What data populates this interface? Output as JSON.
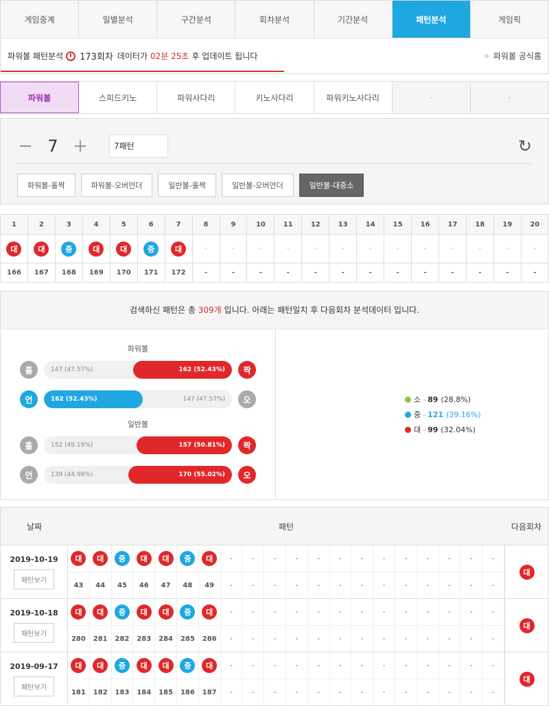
{
  "tabs": [
    "게임중계",
    "일별분석",
    "구간분석",
    "회차분석",
    "기간분석",
    "패턴분석",
    "게임픽"
  ],
  "active_tab": 5,
  "notice": {
    "prefix": "파워볼 패턴분석",
    "round": "173회차",
    "mid": "데이터가",
    "time": "02분 25초",
    "suffix": "후 업데이트 됩니다",
    "link": "파워볼 공식홈"
  },
  "subtabs": [
    "파워볼",
    "스피드키노",
    "파워사다리",
    "키노사다리",
    "파워키노사다리",
    "-",
    "-"
  ],
  "control": {
    "minus": "−",
    "value": "7",
    "plus": "+",
    "pattern_input": "7패턴",
    "buttons": [
      "파워볼-홀짝",
      "파워볼-오버언더",
      "일반볼-홀짝",
      "일반볼-오버언더",
      "일반볼-대중소"
    ]
  },
  "pattern": {
    "headers": [
      "1",
      "2",
      "3",
      "4",
      "5",
      "6",
      "7",
      "8",
      "9",
      "10",
      "11",
      "12",
      "13",
      "14",
      "15",
      "16",
      "17",
      "18",
      "19",
      "20"
    ],
    "balls": [
      "대",
      "대",
      "중",
      "대",
      "대",
      "중",
      "대",
      "-",
      "-",
      "-",
      "-",
      "-",
      "-",
      "-",
      "-",
      "-",
      "-",
      "-",
      "-",
      "-"
    ],
    "rounds": [
      "166",
      "167",
      "168",
      "169",
      "170",
      "171",
      "172",
      "-",
      "-",
      "-",
      "-",
      "-",
      "-",
      "-",
      "-",
      "-",
      "-",
      "-",
      "-",
      "-"
    ]
  },
  "result": {
    "pre": "검색하신 패턴은 총",
    "count": "309개",
    "post": "입니다. 아래는 패턴일치 후 다음회차 분석데이터 입니다."
  },
  "stats": {
    "power_title": "파워볼",
    "normal_title": "일반볼",
    "bars": [
      {
        "left": "홀",
        "right": "짝",
        "left_text": "147 (47.57%)",
        "right_text": "162 (52.43%)",
        "fill_side": "right",
        "pct": 52.43,
        "color": "#e0282b"
      },
      {
        "left": "언",
        "right": "오",
        "left_text": "162 (52.43%)",
        "right_text": "147 (47.57%)",
        "fill_side": "left",
        "pct": 52.43,
        "color": "#1ea7e1"
      },
      {
        "left": "홀",
        "right": "짝",
        "left_text": "152 (49.19%)",
        "right_text": "157 (50.81%)",
        "fill_side": "right",
        "pct": 50.81,
        "color": "#e0282b"
      },
      {
        "left": "언",
        "right": "오",
        "left_text": "139 (44.98%)",
        "right_text": "170 (55.02%)",
        "fill_side": "right",
        "pct": 55.02,
        "color": "#e0282b"
      }
    ],
    "legend": [
      {
        "label": "소",
        "value": "89",
        "pct": "(28.8%)",
        "color": "#8cc63e"
      },
      {
        "label": "중",
        "value": "121",
        "pct": "(39.16%)",
        "color": "#1ea7e1"
      },
      {
        "label": "대",
        "value": "99",
        "pct": "(32.04%)",
        "color": "#e0282b"
      }
    ]
  },
  "history": {
    "headers": {
      "date": "날짜",
      "pattern": "패턴",
      "next": "다음회차"
    },
    "view_label": "패턴보기",
    "rows": [
      {
        "date": "2019-10-19",
        "balls": [
          "대",
          "대",
          "중",
          "대",
          "대",
          "중",
          "대"
        ],
        "rounds": [
          "43",
          "44",
          "45",
          "46",
          "47",
          "48",
          "49"
        ],
        "next": "대"
      },
      {
        "date": "2019-10-18",
        "balls": [
          "대",
          "대",
          "중",
          "대",
          "대",
          "중",
          "대"
        ],
        "rounds": [
          "280",
          "281",
          "282",
          "283",
          "284",
          "285",
          "286"
        ],
        "next": "대"
      },
      {
        "date": "2019-09-17",
        "balls": [
          "대",
          "대",
          "중",
          "대",
          "대",
          "중",
          "대"
        ],
        "rounds": [
          "181",
          "182",
          "183",
          "184",
          "185",
          "186",
          "187"
        ],
        "next": "대"
      }
    ]
  }
}
